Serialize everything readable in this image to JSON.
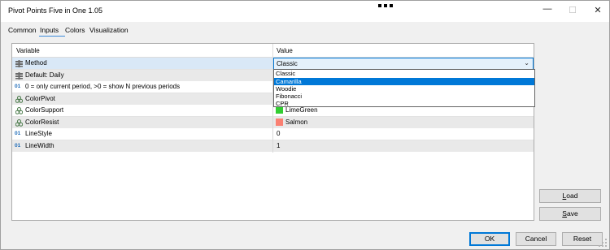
{
  "window": {
    "title": "Pivot Points Five in One 1.05",
    "minimize_icon": "minimize-icon",
    "maximize_icon": "maximize-icon",
    "close_icon": "close-icon"
  },
  "tabs": [
    {
      "label": "Common",
      "active": false
    },
    {
      "label": "Inputs",
      "active": true
    },
    {
      "label": "Colors",
      "active": false
    },
    {
      "label": "Visualization",
      "active": false
    }
  ],
  "grid": {
    "headers": {
      "variable": "Variable",
      "value": "Value"
    },
    "rows": [
      {
        "icon": "enum-icon",
        "name": "Method",
        "value": "Classic"
      },
      {
        "icon": "enum-icon",
        "name": "Default: Daily",
        "value": ""
      },
      {
        "icon": "int-icon",
        "icon_text": "01",
        "name": "0 = only current period, >0 = show N previous periods",
        "value": ""
      },
      {
        "icon": "color-icon",
        "name": "ColorPivot",
        "value": ""
      },
      {
        "icon": "color-icon",
        "name": "ColorSupport",
        "value": "LimeGreen",
        "swatch": "#32cd32"
      },
      {
        "icon": "color-icon",
        "name": "ColorResist",
        "value": "Salmon",
        "swatch": "#fa8072"
      },
      {
        "icon": "int-icon",
        "icon_text": "01",
        "name": "LineStyle",
        "value": "0"
      },
      {
        "icon": "int-icon",
        "icon_text": "01",
        "name": "LineWidth",
        "value": "1"
      }
    ]
  },
  "dropdown": {
    "selected": "Camarilla",
    "options": [
      "Classic",
      "Camarilla",
      "Woodie",
      "Fibonacci",
      "CPR"
    ]
  },
  "buttons": {
    "load": {
      "label": "Load",
      "mnemonic": "L"
    },
    "save": {
      "label": "Save",
      "mnemonic": "S"
    },
    "ok": "OK",
    "cancel": "Cancel",
    "reset": "Reset"
  },
  "colors": {
    "accent": "#0078d7",
    "selected_row": "#d9e8f7",
    "int_icon": "#1e6bb8"
  }
}
